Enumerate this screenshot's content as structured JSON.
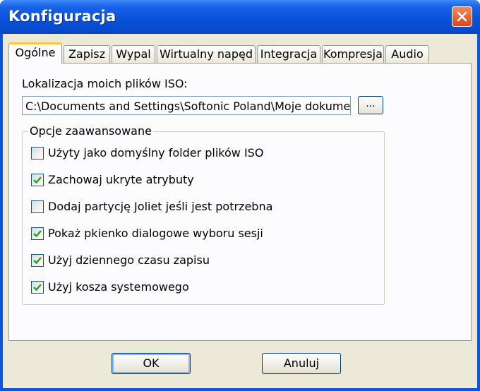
{
  "window": {
    "title": "Konfiguracja"
  },
  "tabs": [
    {
      "label": "Ogólne",
      "active": true
    },
    {
      "label": "Zapisz"
    },
    {
      "label": "Wypal"
    },
    {
      "label": "Wirtualny napęd"
    },
    {
      "label": "Integracja"
    },
    {
      "label": "Kompresja"
    },
    {
      "label": "Audio"
    }
  ],
  "general": {
    "iso_location_label": "Lokalizacja moich plików ISO:",
    "iso_path_value": "C:\\Documents and Settings\\Softonic Poland\\Moje dokument",
    "browse_label": "...",
    "advanced_group_label": "Opcje zaawansowane",
    "options": [
      {
        "label": "Użyty jako domyślny folder plików ISO",
        "checked": false
      },
      {
        "label": "Zachowaj ukryte atrybuty",
        "checked": true
      },
      {
        "label": "Dodaj partycję Joliet jeśli jest potrzebna",
        "checked": false
      },
      {
        "label": "Pokaż pkienko dialogowe wyboru sesji",
        "checked": true
      },
      {
        "label": "Użyj dziennego czasu zapisu",
        "checked": true
      },
      {
        "label": "Użyj kosza systemowego",
        "checked": true
      }
    ]
  },
  "buttons": {
    "ok": "OK",
    "cancel": "Anuluj"
  },
  "colors": {
    "titlebar": "#0a55dd",
    "close": "#d9461c",
    "active_tab_highlight": "#ffc83c",
    "checkmark": "#21a121"
  },
  "icons": {
    "close": "close-icon",
    "check": "checkmark-icon"
  }
}
